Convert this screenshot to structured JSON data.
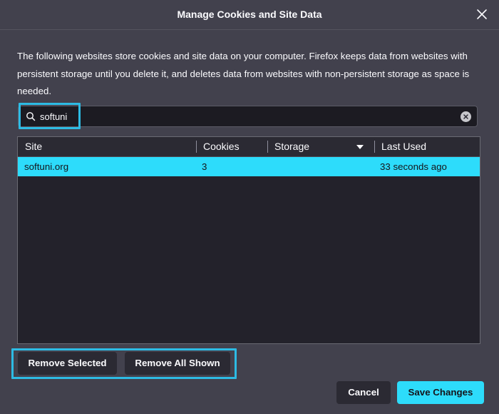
{
  "dialog": {
    "title": "Manage Cookies and Site Data",
    "close_icon": "close-icon",
    "description": "The following websites store cookies and site data on your computer. Firefox keeps data from websites with persistent storage until you delete it, and deletes data from websites with non-persistent storage as space is needed."
  },
  "search": {
    "value": "softuni",
    "search_icon": "search-icon",
    "clear_icon": "clear-icon"
  },
  "table": {
    "columns": [
      "Site",
      "Cookies",
      "Storage",
      "Last Used"
    ],
    "sorted_column": "Storage",
    "rows": [
      {
        "site": "softuni.org",
        "cookies": "3",
        "storage": "",
        "last_used": "33 seconds ago",
        "selected": true
      }
    ]
  },
  "buttons": {
    "remove_selected": "Remove Selected",
    "remove_all_shown": "Remove All Shown",
    "cancel": "Cancel",
    "save_changes": "Save Changes"
  },
  "colors": {
    "background": "#42414d",
    "accent": "#2ddcfb",
    "highlight_outline": "#2dbbe4",
    "table_background": "#23222b"
  }
}
